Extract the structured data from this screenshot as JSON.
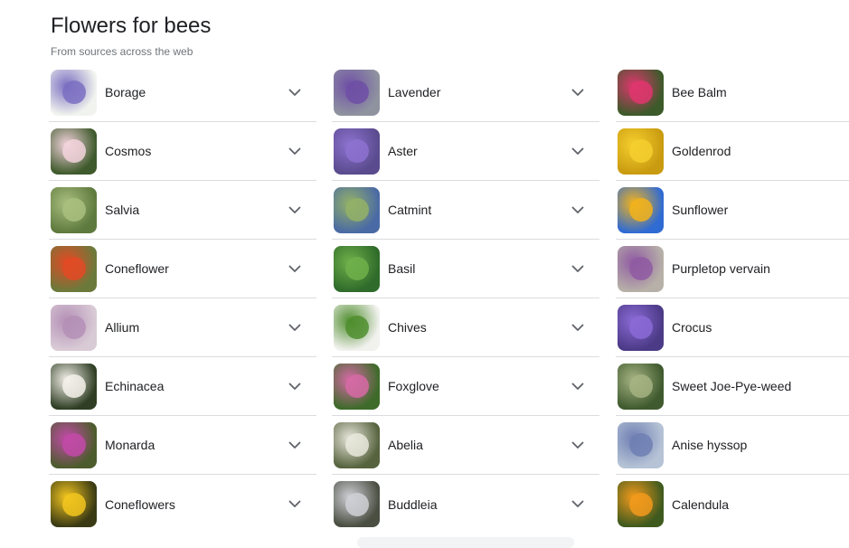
{
  "header": {
    "title": "Flowers for bees",
    "subtitle": "From sources across the web"
  },
  "columns": [
    {
      "items": [
        {
          "label": "Borage",
          "icon": "borage-thumbnail",
          "colors": [
            "#f1f3ee",
            "#7b6fc2"
          ]
        },
        {
          "label": "Cosmos",
          "icon": "cosmos-thumbnail",
          "colors": [
            "#3f5a2c",
            "#f2d3dc"
          ]
        },
        {
          "label": "Salvia",
          "icon": "salvia-thumbnail",
          "colors": [
            "#5f7a3e",
            "#a9bf7f"
          ]
        },
        {
          "label": "Coneflower",
          "icon": "coneflower-thumbnail",
          "colors": [
            "#6b7a3b",
            "#e24a24"
          ]
        },
        {
          "label": "Allium",
          "icon": "allium-thumbnail",
          "colors": [
            "#d9cbd6",
            "#b48fb6"
          ]
        },
        {
          "label": "Echinacea",
          "icon": "echinacea-thumbnail",
          "colors": [
            "#2f3e24",
            "#f4f1ea"
          ]
        },
        {
          "label": "Monarda",
          "icon": "monarda-thumbnail",
          "colors": [
            "#4c5c2c",
            "#c24aa8"
          ]
        },
        {
          "label": "Coneflowers",
          "icon": "coneflowers-thumbnail",
          "colors": [
            "#3a3a14",
            "#f2c51f"
          ]
        }
      ]
    },
    {
      "items": [
        {
          "label": "Lavender",
          "icon": "lavender-thumbnail",
          "colors": [
            "#8f93a0",
            "#6f4fa6"
          ]
        },
        {
          "label": "Aster",
          "icon": "aster-thumbnail",
          "colors": [
            "#5a4b8e",
            "#8d72d0"
          ]
        },
        {
          "label": "Catmint",
          "icon": "catmint-thumbnail",
          "colors": [
            "#4a6aa5",
            "#93b167"
          ]
        },
        {
          "label": "Basil",
          "icon": "basil-thumbnail",
          "colors": [
            "#2f6b2a",
            "#6fb04a"
          ]
        },
        {
          "label": "Chives",
          "icon": "chives-thumbnail",
          "colors": [
            "#f1f1ee",
            "#4f8e2e"
          ]
        },
        {
          "label": "Foxglove",
          "icon": "foxglove-thumbnail",
          "colors": [
            "#3e6b2a",
            "#d66aa6"
          ]
        },
        {
          "label": "Abelia",
          "icon": "abelia-thumbnail",
          "colors": [
            "#56633e",
            "#e9e7dc"
          ]
        },
        {
          "label": "Buddleia",
          "icon": "buddleia-thumbnail",
          "colors": [
            "#4a4f42",
            "#cfd0d6"
          ]
        }
      ]
    },
    {
      "items": [
        {
          "label": "Bee Balm",
          "icon": "bee-balm-thumbnail",
          "colors": [
            "#3c5a2a",
            "#e0366f"
          ]
        },
        {
          "label": "Goldenrod",
          "icon": "goldenrod-thumbnail",
          "colors": [
            "#c99b10",
            "#f5cf2e"
          ]
        },
        {
          "label": "Sunflower",
          "icon": "sunflower-thumbnail",
          "colors": [
            "#2f6bd3",
            "#f2b31c"
          ]
        },
        {
          "label": "Purpletop vervain",
          "icon": "purpletop-vervain-thumbnail",
          "colors": [
            "#b7b0a8",
            "#8f5aa2"
          ]
        },
        {
          "label": "Crocus",
          "icon": "crocus-thumbnail",
          "colors": [
            "#4b3a86",
            "#8b6ad6"
          ]
        },
        {
          "label": "Sweet Joe-Pye-weed",
          "icon": "sweet-joe-pye-weed-thumbnail",
          "colors": [
            "#3f5a2e",
            "#a6b383"
          ]
        },
        {
          "label": "Anise hyssop",
          "icon": "anise-hyssop-thumbnail",
          "colors": [
            "#b6c3d6",
            "#6f7fb3"
          ]
        },
        {
          "label": "Calendula",
          "icon": "calendula-thumbnail",
          "colors": [
            "#3f5a1e",
            "#f29a1c"
          ]
        }
      ]
    }
  ],
  "chevron_icon": "chevron-down-icon"
}
